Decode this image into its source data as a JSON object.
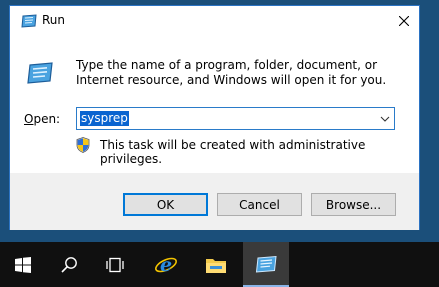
{
  "window": {
    "title": "Run",
    "description": "Type the name of a program, folder, document, or Internet resource, and Windows will open it for you.",
    "open_label_prefix": "",
    "open_label_accel": "O",
    "open_label_rest": "pen:",
    "open_value": "sysprep",
    "admin_notice": "This task will be created with administrative privileges."
  },
  "buttons": {
    "ok": "OK",
    "cancel": "Cancel",
    "browse": "Browse..."
  },
  "taskbar": {
    "items": [
      "windows-start-icon",
      "search-icon",
      "task-view-icon",
      "internet-explorer-icon",
      "file-explorer-icon",
      "run-app-icon"
    ]
  },
  "colors": {
    "accent": "#0078d7",
    "desktop": "#1b4f7a",
    "taskbar": "#101010",
    "selection": "#0a64d0"
  }
}
